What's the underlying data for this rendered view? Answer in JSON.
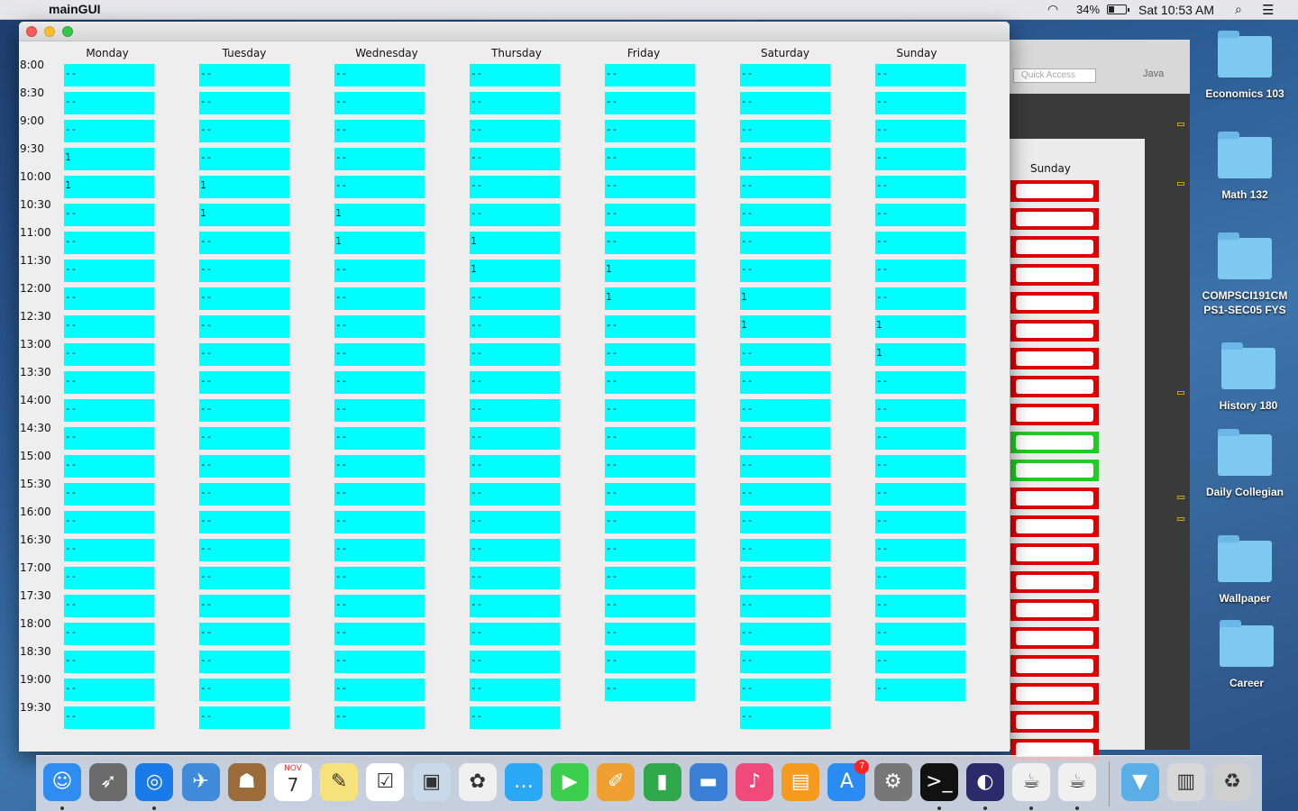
{
  "menubar": {
    "app_name": "mainGUI",
    "battery": "34%",
    "clock": "Sat 10:53 AM"
  },
  "window": {
    "days": [
      "Monday",
      "Tuesday",
      "Wednesday",
      "Thursday",
      "Friday",
      "Saturday",
      "Sunday"
    ],
    "times": [
      "8:00",
      "8:30",
      "9:00",
      "9:30",
      "10:00",
      "10:30",
      "11:00",
      "11:30",
      "12:00",
      "12:30",
      "13:00",
      "13:30",
      "14:00",
      "14:30",
      "15:00",
      "15:30",
      "16:00",
      "16:30",
      "17:00",
      "17:30",
      "18:00",
      "18:30",
      "19:00",
      "19:30"
    ],
    "empty_value": "--",
    "filled_value": "1",
    "slot_color": "#00ffff",
    "schedule": {
      "Monday": [
        "--",
        "--",
        "--",
        "1",
        "1",
        "--",
        "--",
        "--",
        "--",
        "--",
        "--",
        "--",
        "--",
        "--",
        "--",
        "--",
        "--",
        "--",
        "--",
        "--",
        "--",
        "--",
        "--",
        "--"
      ],
      "Tuesday": [
        "--",
        "--",
        "--",
        "--",
        "1",
        "1",
        "--",
        "--",
        "--",
        "--",
        "--",
        "--",
        "--",
        "--",
        "--",
        "--",
        "--",
        "--",
        "--",
        "--",
        "--",
        "--",
        "--",
        "--"
      ],
      "Wednesday": [
        "--",
        "--",
        "--",
        "--",
        "--",
        "1",
        "1",
        "--",
        "--",
        "--",
        "--",
        "--",
        "--",
        "--",
        "--",
        "--",
        "--",
        "--",
        "--",
        "--",
        "--",
        "--",
        "--",
        "--"
      ],
      "Thursday": [
        "--",
        "--",
        "--",
        "--",
        "--",
        "--",
        "1",
        "1",
        "--",
        "--",
        "--",
        "--",
        "--",
        "--",
        "--",
        "--",
        "--",
        "--",
        "--",
        "--",
        "--",
        "--",
        "--",
        "--"
      ],
      "Friday": [
        "--",
        "--",
        "--",
        "--",
        "--",
        "--",
        "--",
        "1",
        "1",
        "--",
        "--",
        "--",
        "--",
        "--",
        "--",
        "--",
        "--",
        "--",
        "--",
        "--",
        "--",
        "--",
        "--"
      ],
      "Saturday": [
        "--",
        "--",
        "--",
        "--",
        "--",
        "--",
        "--",
        "--",
        "1",
        "1",
        "--",
        "--",
        "--",
        "--",
        "--",
        "--",
        "--",
        "--",
        "--",
        "--",
        "--",
        "--",
        "--",
        "--"
      ],
      "Sunday": [
        "--",
        "--",
        "--",
        "--",
        "--",
        "--",
        "--",
        "--",
        "--",
        "1",
        "1",
        "--",
        "--",
        "--",
        "--",
        "--",
        "--",
        "--",
        "--",
        "--",
        "--",
        "--",
        "--"
      ]
    }
  },
  "background_window": {
    "search_placeholder": "Quick Access",
    "perspective": "Java",
    "panel_title": "Sunday",
    "slot_states": [
      "busy",
      "busy",
      "busy",
      "busy",
      "busy",
      "busy",
      "busy",
      "busy",
      "busy",
      "free",
      "free",
      "busy",
      "busy",
      "busy",
      "busy",
      "busy",
      "busy",
      "busy",
      "busy",
      "busy",
      "busy"
    ],
    "busy_color": "#e00000",
    "free_color": "#22cc22"
  },
  "desktop": {
    "icons": [
      "Economics  103",
      "Math 132",
      "COMPSCI191CM PS1-SEC05 FYS",
      "History 180",
      "Daily Collegian",
      "Wallpaper",
      "Career"
    ]
  },
  "dock": {
    "apps": [
      "finder-icon",
      "launchpad-icon",
      "safari-icon",
      "mail-icon",
      "contacts-icon",
      "calendar-icon",
      "notes-icon",
      "reminders-icon",
      "preview-icon",
      "photos-icon",
      "messages-icon",
      "facetime-icon",
      "pages-icon",
      "numbers-icon",
      "keynote-icon",
      "itunes-icon",
      "ibooks-icon",
      "app-store-icon",
      "system-preferences-icon",
      "terminal-icon",
      "eclipse-icon",
      "java-icon",
      "java-icon-2",
      "downloads-folder-icon",
      "preview-stack-icon",
      "trash-icon"
    ],
    "calendar_month": "NOV",
    "calendar_day": "7",
    "app_store_badge": "7"
  }
}
